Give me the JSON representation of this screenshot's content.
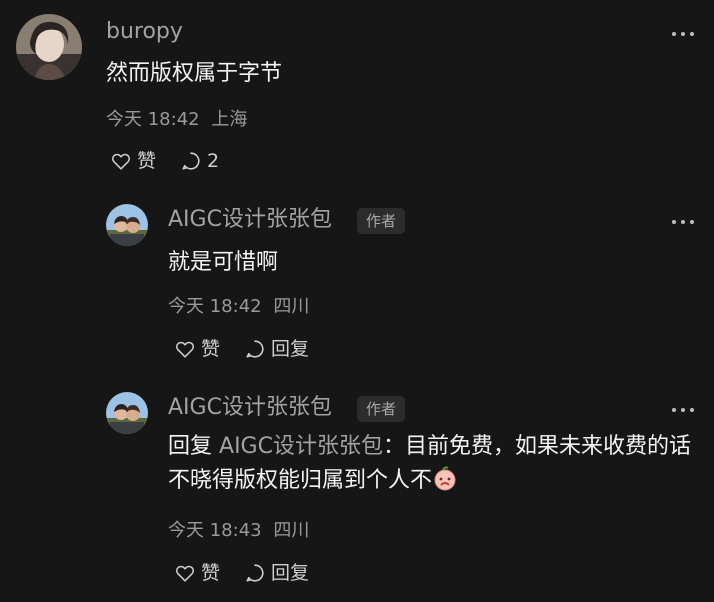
{
  "comments": [
    {
      "username": "buropy",
      "text": "然而版权属于字节",
      "time": "今天 18:42",
      "location": "上海",
      "like_label": "赞",
      "reply_count": "2"
    }
  ],
  "replies": [
    {
      "username": "AIGC设计张张包",
      "badge": "作者",
      "text": "就是可惜啊",
      "time": "今天 18:42",
      "location": "四川",
      "like_label": "赞",
      "reply_label": "回复"
    },
    {
      "username": "AIGC设计张张包",
      "badge": "作者",
      "reply_prefix": "回复",
      "reply_target": "AIGC设计张张包",
      "text": "：目前免费，如果未来收费的话不晓得版权能归属到个人不",
      "emoji": "sad-face-emoji",
      "time": "今天 18:43",
      "location": "四川",
      "like_label": "赞",
      "reply_label": "回复"
    }
  ],
  "colors": {
    "background": "#161616",
    "username": "#a3a3a3",
    "text": "#f3f3f3",
    "meta": "#9a9a9a"
  }
}
